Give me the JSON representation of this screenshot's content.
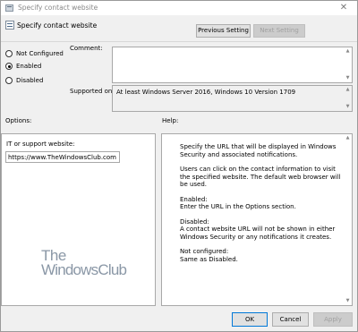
{
  "window": {
    "title": "Specify contact website",
    "close_glyph": "✕"
  },
  "header": {
    "setting_name": "Specify contact website"
  },
  "nav": {
    "previous_label": "Previous Setting",
    "next_label": "Next Setting"
  },
  "state": {
    "options": [
      {
        "label": "Not Configured",
        "checked": false
      },
      {
        "label": "Enabled",
        "checked": true
      },
      {
        "label": "Disabled",
        "checked": false
      }
    ]
  },
  "comment": {
    "label": "Comment:",
    "value": ""
  },
  "supported": {
    "label": "Supported on:",
    "value": "At least Windows Server 2016, Windows 10 Version 1709"
  },
  "options_section": {
    "title": "Options:",
    "field_label": "IT or support website:",
    "field_value": "https://www.TheWindowsClub.com"
  },
  "help_section": {
    "title": "Help:",
    "paragraphs": [
      "Specify the URL that will be displayed in Windows Security and associated notifications.",
      "Users can click on the contact information to visit the specified website. The default web browser will be used.",
      "Enabled:",
      "Enter the URL in the Options section.",
      "Disabled:",
      "A contact website URL will not be shown in either Windows Security or any notifications it creates.",
      "Not configured:",
      "Same as Disabled."
    ]
  },
  "watermark": {
    "line1": "The",
    "line2": "WindowsClub"
  },
  "footer": {
    "ok_label": "OK",
    "cancel_label": "Cancel",
    "apply_label": "Apply"
  },
  "colors": {
    "window_bg": "#f0f0f0",
    "primary_border": "#0078d7",
    "disabled_text": "#a0a0a0"
  },
  "icons": {
    "title": "policy-icon",
    "header": "policy-icon"
  }
}
